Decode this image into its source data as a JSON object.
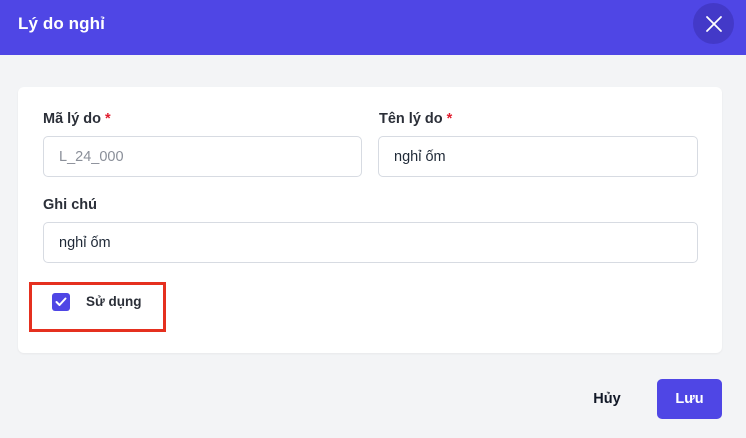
{
  "dialog": {
    "title": "Lý do nghỉ",
    "close_icon": "close-icon"
  },
  "form": {
    "code": {
      "label": "Mã lý do",
      "required_mark": "*",
      "value": "L_24_000",
      "readonly": true
    },
    "name": {
      "label": "Tên lý do",
      "required_mark": "*",
      "value": "nghỉ ốm"
    },
    "note": {
      "label": "Ghi chú",
      "value": "nghỉ ốm"
    },
    "active": {
      "label": "Sử dụng",
      "checked": true
    }
  },
  "footer": {
    "cancel_label": "Hủy",
    "save_label": "Lưu"
  },
  "colors": {
    "accent": "#4f46e5",
    "required": "#e11d2e",
    "highlight": "#e5301f"
  }
}
